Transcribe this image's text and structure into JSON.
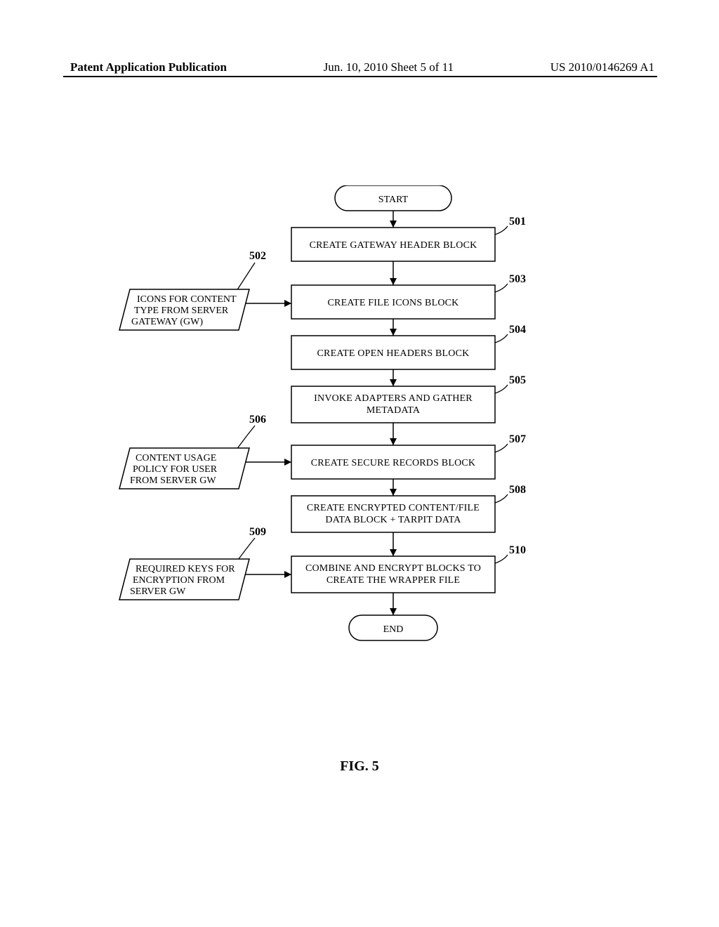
{
  "header": {
    "left": "Patent Application Publication",
    "center": "Jun. 10, 2010  Sheet 5 of 11",
    "right": "US 2010/0146269 A1"
  },
  "figure_label": "FIG. 5",
  "terminals": {
    "start": "START",
    "end": "END"
  },
  "process": {
    "p501": "CREATE GATEWAY HEADER BLOCK",
    "p503": "CREATE FILE ICONS BLOCK",
    "p504": "CREATE OPEN HEADERS BLOCK",
    "p505_l1": "INVOKE ADAPTERS AND GATHER",
    "p505_l2": "METADATA",
    "p507": "CREATE SECURE RECORDS BLOCK",
    "p508_l1": "CREATE ENCRYPTED CONTENT/FILE",
    "p508_l2": "DATA BLOCK + TARPIT DATA",
    "p510_l1": "COMBINE AND ENCRYPT BLOCKS TO",
    "p510_l2": "CREATE THE WRAPPER FILE"
  },
  "data_inputs": {
    "d502_l1": "ICONS FOR CONTENT",
    "d502_l2": "TYPE FROM SERVER",
    "d502_l3": "GATEWAY (GW)",
    "d506_l1": "CONTENT USAGE",
    "d506_l2": "POLICY FOR USER",
    "d506_l3": "FROM SERVER GW",
    "d509_l1": "REQUIRED KEYS FOR",
    "d509_l2": "ENCRYPTION FROM",
    "d509_l3": "SERVER GW"
  },
  "refs": {
    "r501": "501",
    "r502": "502",
    "r503": "503",
    "r504": "504",
    "r505": "505",
    "r506": "506",
    "r507": "507",
    "r508": "508",
    "r509": "509",
    "r510": "510"
  }
}
